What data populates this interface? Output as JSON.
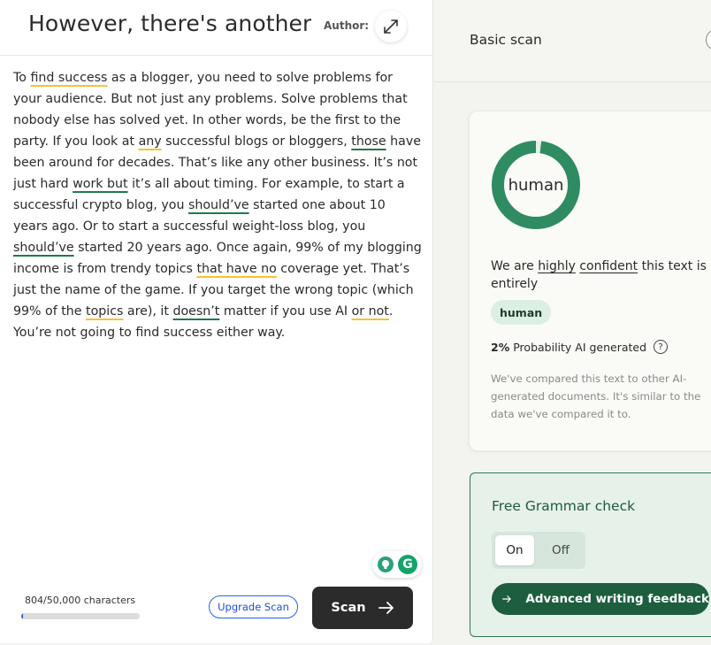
{
  "editor": {
    "title": "However, there's another st",
    "author_label": "Author:",
    "paragraph": [
      {
        "t": "To "
      },
      {
        "t": "find success",
        "u": "y"
      },
      {
        "t": " as a blogger, you need to solve problems for your audience. But not just any problems. Solve problems that nobody else has solved yet. In other words, be the first to the party. If you look at "
      },
      {
        "t": "any",
        "u": "y"
      },
      {
        "t": " successful blogs or bloggers, "
      },
      {
        "t": "those",
        "u": "g"
      },
      {
        "t": " have been around for decades. That’s like any other business. It’s not just hard "
      },
      {
        "t": "work but",
        "u": "g"
      },
      {
        "t": " it’s all about timing. For example, to start a successful crypto blog, you "
      },
      {
        "t": "should’ve",
        "u": "g"
      },
      {
        "t": " started one about 10 years ago. Or to start a successful weight-loss blog, you "
      },
      {
        "t": "should’ve",
        "u": "g"
      },
      {
        "t": " started 20 years ago. Once again, 99% of my blogging income is from trendy topics "
      },
      {
        "t": "that have no",
        "u": "y"
      },
      {
        "t": " coverage yet. That’s just the name of the game. If you target the wrong topic (which 99% of the "
      },
      {
        "t": "topics",
        "u": "y"
      },
      {
        "t": " are), it "
      },
      {
        "t": "doesn’t",
        "u": "g"
      },
      {
        "t": " matter if you use AI "
      },
      {
        "t": "or not",
        "u": "y"
      },
      {
        "t": ". You’re not going to find success either way."
      }
    ],
    "char_count": "804/50,000 characters",
    "char_progress": 0.016,
    "upgrade_label": "Upgrade Scan",
    "scan_label": "Scan"
  },
  "panel": {
    "header_title": "Basic scan",
    "donut_label": "human",
    "human_fraction": 0.98,
    "verdict_prefix": "We are ",
    "verdict_word1": "highly",
    "verdict_space": " ",
    "verdict_word2": "confident",
    "verdict_suffix": " this text is entirely",
    "badge": "human",
    "prob_value": "2%",
    "prob_text": "Probability AI generated",
    "help_glyph": "?",
    "note": "We've compared this text to other AI-generated documents. It's similar to the data we've compared it to."
  },
  "grammar": {
    "title": "Free Grammar check",
    "on_label": "On",
    "off_label": "Off",
    "advanced_label": "Advanced writing feedback"
  },
  "colors": {
    "donut": "#2e8b62",
    "donut_track": "#e4efe8",
    "accent_blue": "#2563eb",
    "grammar_green": "#1c5e3d"
  },
  "icons": {
    "expand": "expand-arrows-icon",
    "arrow": "arrow-right-icon",
    "grammarly": "grammarly-g-icon"
  }
}
